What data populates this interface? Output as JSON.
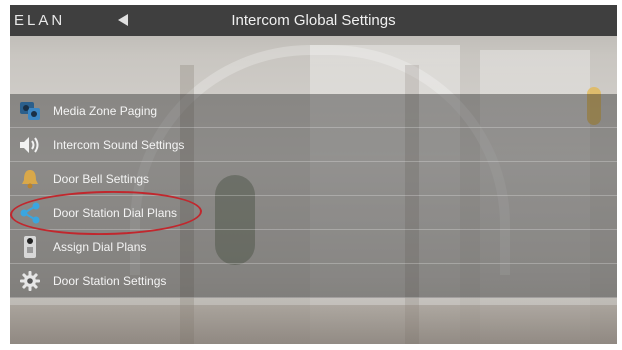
{
  "header": {
    "logo_text": "ELAN",
    "title": "Intercom Global Settings"
  },
  "menu": {
    "items": [
      {
        "label": "Media Zone Paging",
        "icon": "media-zone-paging-icon"
      },
      {
        "label": "Intercom Sound Settings",
        "icon": "speaker-icon"
      },
      {
        "label": "Door Bell Settings",
        "icon": "door-bell-icon"
      },
      {
        "label": "Door Station Dial Plans",
        "icon": "share-nodes-icon"
      },
      {
        "label": "Assign Dial Plans",
        "icon": "door-station-device-icon"
      },
      {
        "label": "Door Station Settings",
        "icon": "gear-icon"
      }
    ]
  },
  "annotation": {
    "color": "#c1272d"
  }
}
